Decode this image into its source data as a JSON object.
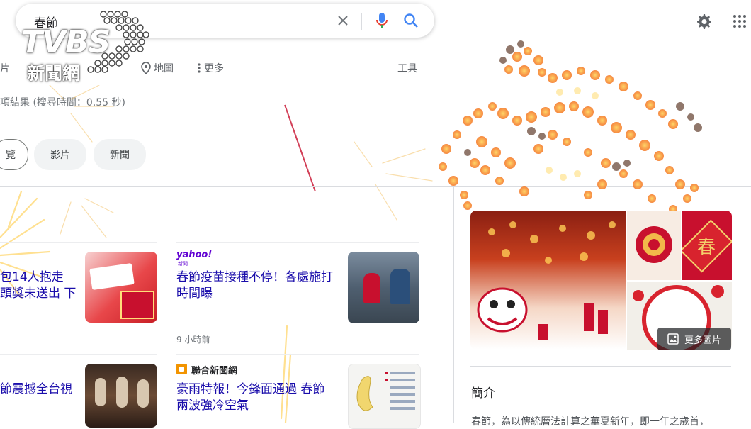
{
  "search": {
    "value": "春節"
  },
  "logo": {
    "brand": "TVBS",
    "subtitle": "新聞網"
  },
  "tabs": {
    "partial_first": "片",
    "maps": "地圖",
    "more": "更多",
    "tools": "工具"
  },
  "stats": "項結果 (搜尋時間：0.55 秒)",
  "chips": [
    {
      "label": "覽"
    },
    {
      "label": "影片"
    },
    {
      "label": "新聞"
    }
  ],
  "news": [
    {
      "title_line1": "包14人抱走",
      "title_line2": "頭獎未送出 下"
    },
    {
      "source": "yahoo!",
      "source_sub": "新聞",
      "title_line1": "春節疫苗接種不停！各處施打",
      "title_line2": "時間曝",
      "time": "9 小時前"
    },
    {
      "title_line1": "節震撼全台視"
    },
    {
      "source": "聯合新聞網",
      "title_line1": "豪雨特報！今鋒面通過 春節",
      "title_line2": "兩波強冷空氣"
    }
  ],
  "knowledge_panel": {
    "more_images": "更多圖片",
    "intro_title": "簡介",
    "intro_text": "春節，為以傳統曆法計算之華夏新年，即一年之歲首，"
  },
  "colors": {
    "link": "#1a0dab",
    "accent_red": "#c8102e",
    "mic_blue": "#4285f4"
  }
}
